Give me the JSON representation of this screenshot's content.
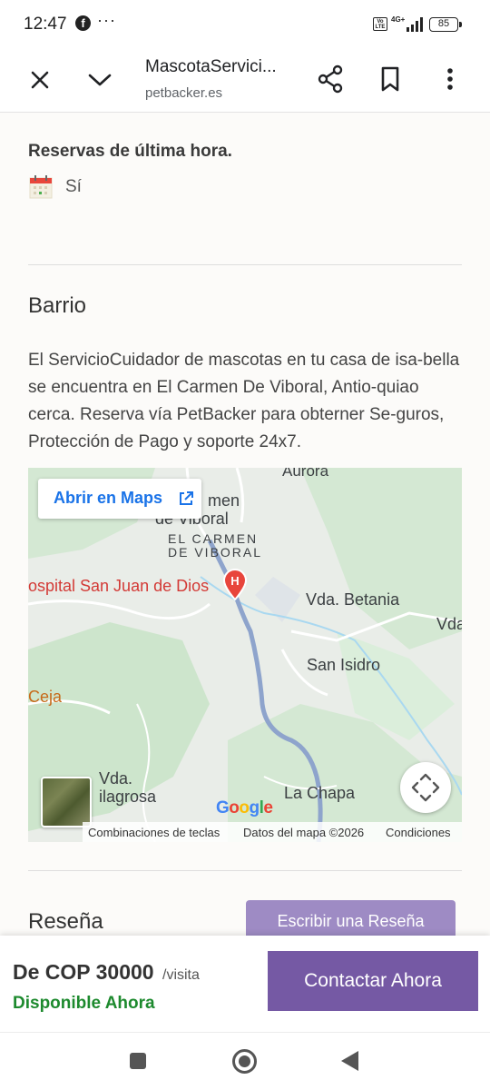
{
  "status_bar": {
    "time": "12:47",
    "more": "···",
    "volte": "Vo LTE",
    "network": "4G+",
    "battery": "85"
  },
  "browser": {
    "title": "MascotaServici...",
    "url": "petbacker.es"
  },
  "last_minute": {
    "heading": "Reservas de última hora.",
    "value": "Sí"
  },
  "barrio": {
    "heading": "Barrio",
    "text": "El ServicioCuidador de mascotas en tu casa de isa-bella se encuentra en El Carmen De Viboral, Antio-quiao cerca. Reserva vía PetBacker para obterner Se-guros, Protección de Pago y soporte 24x7."
  },
  "map": {
    "open_maps_label": "Abrir en Maps",
    "labels": {
      "aurora": "Aurora",
      "carmen_partial_1": "men",
      "carmen_partial_2": "de Viboral",
      "town_line_1": "EL CARMEN",
      "town_line_2": "DE VIBORAL",
      "hospital": "ospital San Juan de Dios",
      "vda_betania": "Vda. Betania",
      "vda_edge": "Vda",
      "san_isidro": "San Isidro",
      "ceja": "Ceja",
      "vda_milagrosa_1": "Vda.",
      "vda_milagrosa_2": "ilagrosa",
      "la_chapa": "La Chapa"
    },
    "google": "Google",
    "footer": {
      "shortcuts": "Combinaciones de teclas",
      "map_data": "Datos del mapa ©2026",
      "terms": "Condiciones"
    },
    "colors": {
      "water": "#a9d8f0",
      "road": "#8ea4cc",
      "green": "#cfe6cf",
      "hospital_marker": "#e8453c"
    }
  },
  "reviews": {
    "heading": "Reseña",
    "write_button": "Escribir una Reseña"
  },
  "booking": {
    "price": "De COP 30000",
    "unit": "/visita",
    "availability": "Disponible Ahora",
    "contact_button": "Contactar Ahora",
    "accent_color": "#7559a4",
    "availability_color": "#1d8a2e"
  },
  "icons": [
    "close-icon",
    "chevron-down-icon",
    "share-icon",
    "bookmark-icon",
    "more-vert-icon",
    "calendar-icon",
    "external-link-icon",
    "hospital-marker-icon",
    "fullscreen-icon",
    "nav-recents-icon",
    "nav-home-icon",
    "nav-back-icon"
  ]
}
